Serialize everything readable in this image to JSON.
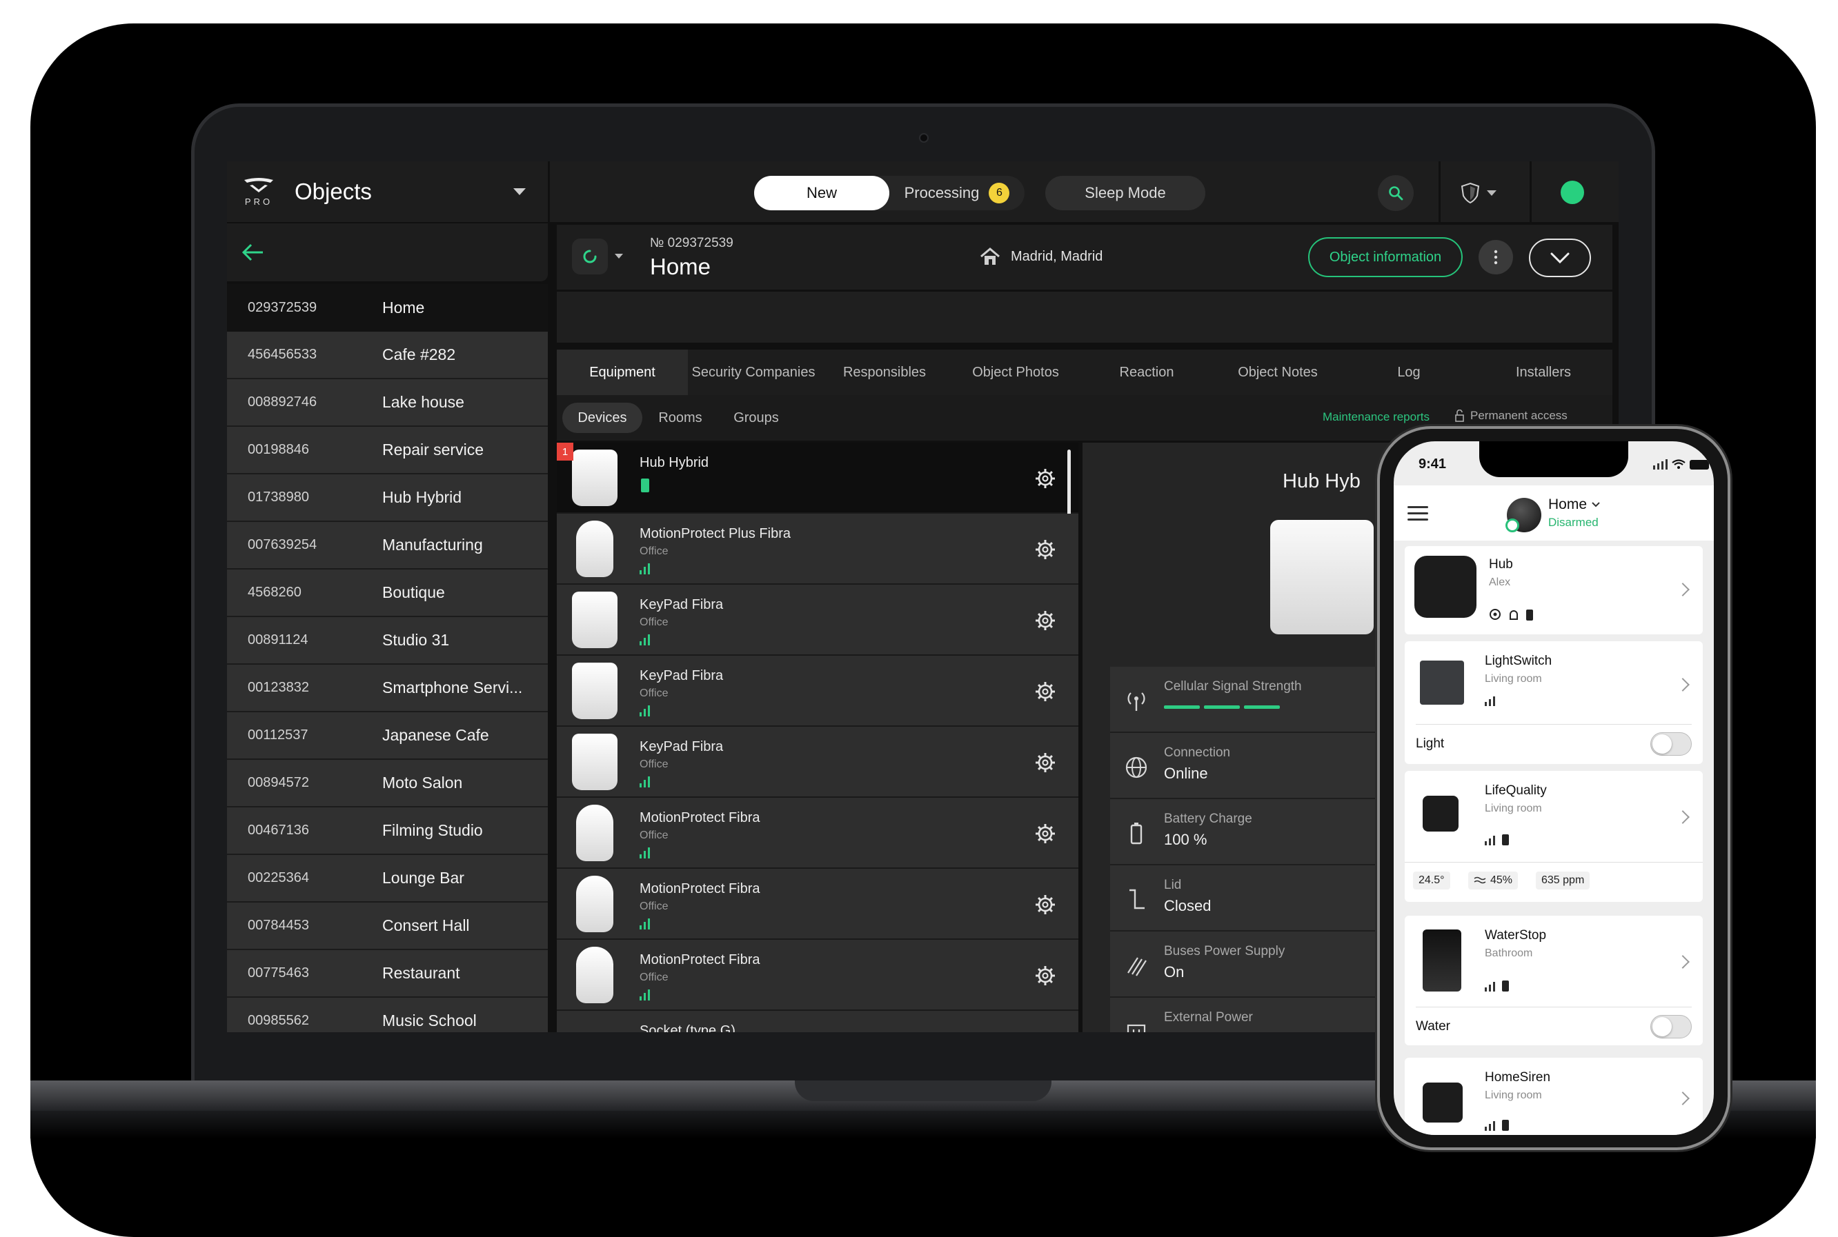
{
  "app": {
    "title": "Objects",
    "logo_text": "PRO"
  },
  "topbar": {
    "tab_new": "New",
    "tab_processing": "Processing",
    "processing_count": "6",
    "sleep_mode": "Sleep Mode",
    "status_color": "#28d07f"
  },
  "objects": [
    {
      "id": "029372539",
      "name": "Home"
    },
    {
      "id": "456456533",
      "name": "Cafe #282"
    },
    {
      "id": "008892746",
      "name": "Lake house"
    },
    {
      "id": "00198846",
      "name": "Repair service"
    },
    {
      "id": "01738980",
      "name": "Hub Hybrid"
    },
    {
      "id": "007639254",
      "name": "Manufacturing"
    },
    {
      "id": "4568260",
      "name": "Boutique"
    },
    {
      "id": "00891124",
      "name": "Studio 31"
    },
    {
      "id": "00123832",
      "name": "Smartphone Servi..."
    },
    {
      "id": "00112537",
      "name": "Japanese Cafe"
    },
    {
      "id": "00894572",
      "name": "Moto Salon"
    },
    {
      "id": "00467136",
      "name": "Filming Studio"
    },
    {
      "id": "00225364",
      "name": "Lounge Bar"
    },
    {
      "id": "00784453",
      "name": "Consert Hall"
    },
    {
      "id": "00775463",
      "name": "Restaurant"
    },
    {
      "id": "00985562",
      "name": "Music School"
    }
  ],
  "object": {
    "number": "№ 029372539",
    "title": "Home",
    "address": "Madrid, Madrid",
    "info_button": "Object information"
  },
  "tabs": [
    "Equipment",
    "Security Companies",
    "Responsibles",
    "Object Photos",
    "Reaction",
    "Object Notes",
    "Log",
    "Installers"
  ],
  "subtabs": [
    "Devices",
    "Rooms",
    "Groups"
  ],
  "maintenance_reports": "Maintenance reports",
  "permanent_access": "Permanent access",
  "devices": [
    {
      "name": "Hub Hybrid",
      "room": "",
      "alert": "1"
    },
    {
      "name": "MotionProtect Plus Fibra",
      "room": "Office"
    },
    {
      "name": "KeyPad Fibra",
      "room": "Office"
    },
    {
      "name": "KeyPad Fibra",
      "room": "Office"
    },
    {
      "name": "KeyPad Fibra",
      "room": "Office"
    },
    {
      "name": "MotionProtect Fibra",
      "room": "Office"
    },
    {
      "name": "MotionProtect Fibra",
      "room": "Office"
    },
    {
      "name": "MotionProtect Fibra",
      "room": "Office"
    },
    {
      "name": "Socket (type G)",
      "room": ""
    }
  ],
  "detail": {
    "title": "Hub Hyb",
    "props": [
      {
        "label": "Cellular Signal Strength",
        "value": ""
      },
      {
        "label": "Connection",
        "value": "Online"
      },
      {
        "label": "Battery Charge",
        "value": "100 %"
      },
      {
        "label": "Lid",
        "value": "Closed"
      },
      {
        "label": "Buses Power Supply",
        "value": "On"
      },
      {
        "label": "External Power",
        "value": ""
      }
    ]
  },
  "phone": {
    "time": "9:41",
    "home": "Home",
    "status": "Disarmed",
    "cards": {
      "hub": {
        "name": "Hub",
        "room": "Alex"
      },
      "light": {
        "name": "LightSwitch",
        "room": "Living room",
        "toggle": "Light"
      },
      "life": {
        "name": "LifeQuality",
        "room": "Living room",
        "temp": "24.5°",
        "humidity": "45%",
        "co2": "635 ppm"
      },
      "water": {
        "name": "WaterStop",
        "room": "Bathroom",
        "toggle": "Water"
      },
      "siren": {
        "name": "HomeSiren",
        "room": "Living room"
      }
    }
  }
}
